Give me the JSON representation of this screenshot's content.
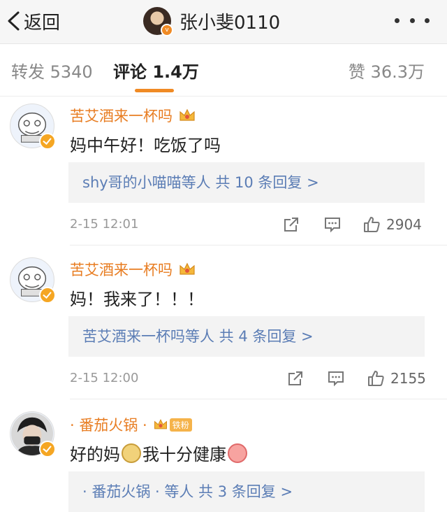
{
  "header": {
    "back_label": "返回",
    "title": "张小斐0110"
  },
  "tabs": {
    "repost": "转发 5340",
    "comment": "评论 1.4万",
    "like": "赞 36.3万",
    "accent_color": "#f08a24"
  },
  "comments": [
    {
      "name": "苦艾酒来一杯吗",
      "text": "妈中午好！吃饭了吗",
      "replies": "shy哥的小喵喵等人  共 10 条回复 >",
      "time": "2-15 12:01",
      "likes": "2904"
    },
    {
      "name": "苦艾酒来一杯吗",
      "text": "妈！我来了！！！",
      "replies": "苦艾酒来一杯吗等人  共 4 条回复 >",
      "time": "2-15 12:00",
      "likes": "2155"
    },
    {
      "name": "· 番茄火锅 ·",
      "fan_tag": "铁粉",
      "text_a": "好的妈",
      "text_b": "我十分健康",
      "replies": "· 番茄火锅 · 等人  共 3 条回复 >"
    }
  ],
  "icons": [
    "chevron-left-icon",
    "more-icon",
    "crown-icon",
    "verified-icon",
    "share-icon",
    "comment-icon",
    "like-icon",
    "doge-emoji-icon",
    "strong-emoji-icon"
  ],
  "colors": {
    "name": "#e87d22",
    "link": "#5b7db5",
    "meta": "#999999"
  }
}
